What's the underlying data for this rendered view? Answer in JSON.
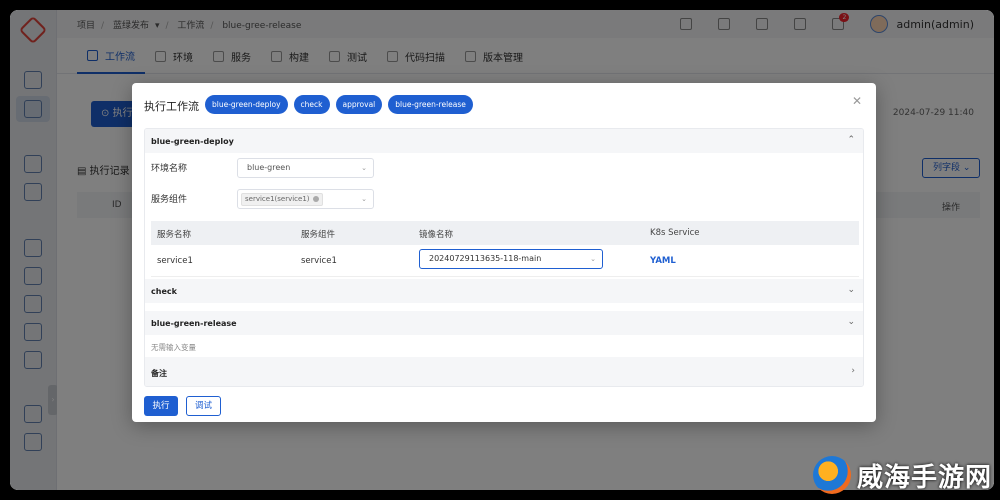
{
  "breadcrumb": [
    "项目",
    "蓝绿发布",
    "工作流",
    "blue-gree-release"
  ],
  "user": {
    "name": "admin(admin)",
    "notification_count": "2"
  },
  "tabs": [
    "工作流",
    "环境",
    "服务",
    "构建",
    "测试",
    "代码扫描",
    "版本管理"
  ],
  "background": {
    "run_button": "执行",
    "latest_time": "2024-07-29 11:40",
    "exec_records": "执行记录",
    "column_field_button": "列字段",
    "table_head": {
      "id": "ID",
      "actions": "操作"
    }
  },
  "dialog": {
    "title": "执行工作流",
    "stages": [
      "blue-green-deploy",
      "check",
      "approval",
      "blue-green-release"
    ],
    "sections": {
      "deploy": {
        "title": "blue-green-deploy",
        "env_label": "环境名称",
        "env_value": "blue-green",
        "component_label": "服务组件",
        "component_tag": "service1(service1)",
        "table_headers": [
          "服务名称",
          "服务组件",
          "镜像名称",
          "K8s Service"
        ],
        "rows": [
          {
            "service": "service1",
            "component": "service1",
            "image": "20240729113635-118-main",
            "k8s": "YAML"
          }
        ]
      },
      "check": {
        "title": "check"
      },
      "release": {
        "title": "blue-green-release",
        "note": "无需输入变量"
      },
      "remark": {
        "title": "备注"
      }
    },
    "buttons": {
      "run": "执行",
      "debug": "调试"
    }
  },
  "watermark": "威海手游网",
  "colors": {
    "primary": "#1f5fd1",
    "mask": "rgba(0,0,0,0.5)"
  }
}
